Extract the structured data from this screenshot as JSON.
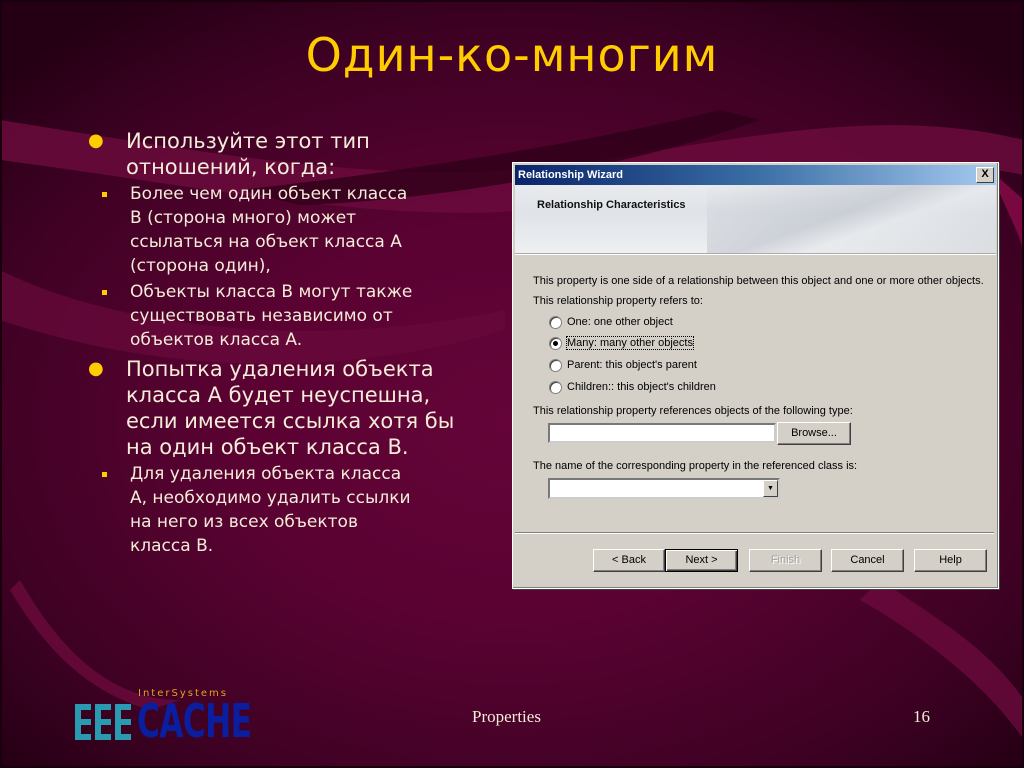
{
  "slide": {
    "title": "Один-ко-многим",
    "bullets": [
      {
        "text": "Используйте этот тип\nотношений, когда:",
        "sub": [
          "Более чем один объект класса\nB (сторона много) может\nссылаться на объект класса A\n(сторона один),",
          "Объекты класса B могут также\nсуществовать независимо от\nобъектов класса A."
        ]
      },
      {
        "text": "Попытка удаления объекта\nкласса A будет неуспешна,\nесли имеется ссылка хотя бы\nна один объект класса B.",
        "sub": [
          "Для удаления объекта класса\nA, необходимо удалить ссылки\nна него из всех объектов\nкласса B."
        ]
      }
    ],
    "footer": {
      "center": "Properties",
      "page_number": "16"
    },
    "logo": {
      "company": "InterSystems",
      "product": "CACHE"
    },
    "colors": {
      "title": "#ffcc00",
      "text": "#f4ecd8",
      "background": "#5a0232",
      "logo_blue": "#0a1ea0",
      "logo_teal": "#2a9ab0"
    }
  },
  "dialog": {
    "title": "Relationship Wizard",
    "close_label": "X",
    "header_title": "Relationship Characteristics",
    "intro": "This property is one side of a relationship between this object and one or more other objects.",
    "refers_label": "This relationship property refers to:",
    "options": [
      {
        "label": "One: one other object",
        "checked": false
      },
      {
        "label": "Many: many other objects",
        "checked": true
      },
      {
        "label": "Parent: this object's parent",
        "checked": false
      },
      {
        "label": "Children:: this object's children",
        "checked": false
      }
    ],
    "type_label": "This relationship property references objects of the following type:",
    "type_value": "",
    "browse_label": "Browse...",
    "prop_label": "The name of the corresponding property in the referenced class is:",
    "prop_value": "",
    "buttons": {
      "back": "< Back",
      "next": "Next >",
      "finish": "Finish",
      "cancel": "Cancel",
      "help": "Help"
    }
  }
}
